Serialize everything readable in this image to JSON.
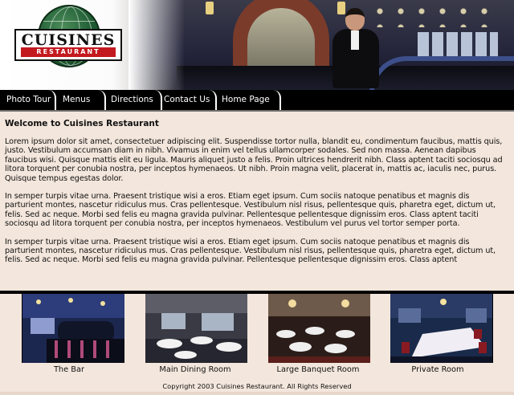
{
  "logo": {
    "title": "CUISINES",
    "subtitle": "RESTAURANT"
  },
  "nav": {
    "items": [
      "Photo Tour",
      "Menus",
      "Directions",
      "Contact Us",
      "Home Page"
    ]
  },
  "main": {
    "title": "Welcome to Cuisines Restaurant",
    "paragraphs": [
      "Lorem ipsum dolor sit amet, consectetuer adipiscing elit. Suspendisse tortor nulla, blandit eu, condimentum faucibus, mattis quis, justo. Vestibulum accumsan diam in nibh. Vivamus in enim vel tellus ullamcorper sodales. Sed non massa. Aenean dapibus faucibus wisi. Quisque mattis elit eu ligula. Mauris aliquet justo a felis. Proin ultrices hendrerit nibh. Class aptent taciti sociosqu ad litora torquent per conubia nostra, per inceptos hymenaeos. Ut nibh. Proin magna velit, placerat in, mattis ac, iaculis nec, purus. Quisque tempus egestas dolor.",
      "In semper turpis vitae urna. Praesent tristique wisi a eros. Etiam eget ipsum. Cum sociis natoque penatibus et magnis dis parturient montes, nascetur ridiculus mus. Cras pellentesque. Vestibulum nisl risus, pellentesque quis, pharetra eget, dictum ut, felis. Sed ac neque. Morbi sed felis eu magna gravida pulvinar. Pellentesque pellentesque dignissim eros. Class aptent taciti sociosqu ad litora torquent per conubia nostra, per inceptos hymenaeos. Vestibulum vel purus vel tortor semper porta.",
      "In semper turpis vitae urna. Praesent tristique wisi a eros. Etiam eget ipsum. Cum sociis natoque penatibus et magnis dis parturient montes, nascetur ridiculus mus. Cras pellentesque. Vestibulum nisl risus, pellentesque quis, pharetra eget, dictum ut, felis. Sed ac neque. Morbi sed felis eu magna gravida pulvinar. Pellentesque pellentesque dignissim eros. Class aptent"
    ]
  },
  "gallery": {
    "captions": [
      "The Bar",
      "Main Dining Room",
      "Large Banquet Room",
      "Private Room"
    ]
  },
  "footer": {
    "copyright": "Copyright 2003 Cuisines Restaurant. All Rights Reserved"
  },
  "colors": {
    "background": "#f3e6dc",
    "nav": "#000000",
    "brand_red": "#c31a20",
    "brand_green": "#1f5d33"
  }
}
